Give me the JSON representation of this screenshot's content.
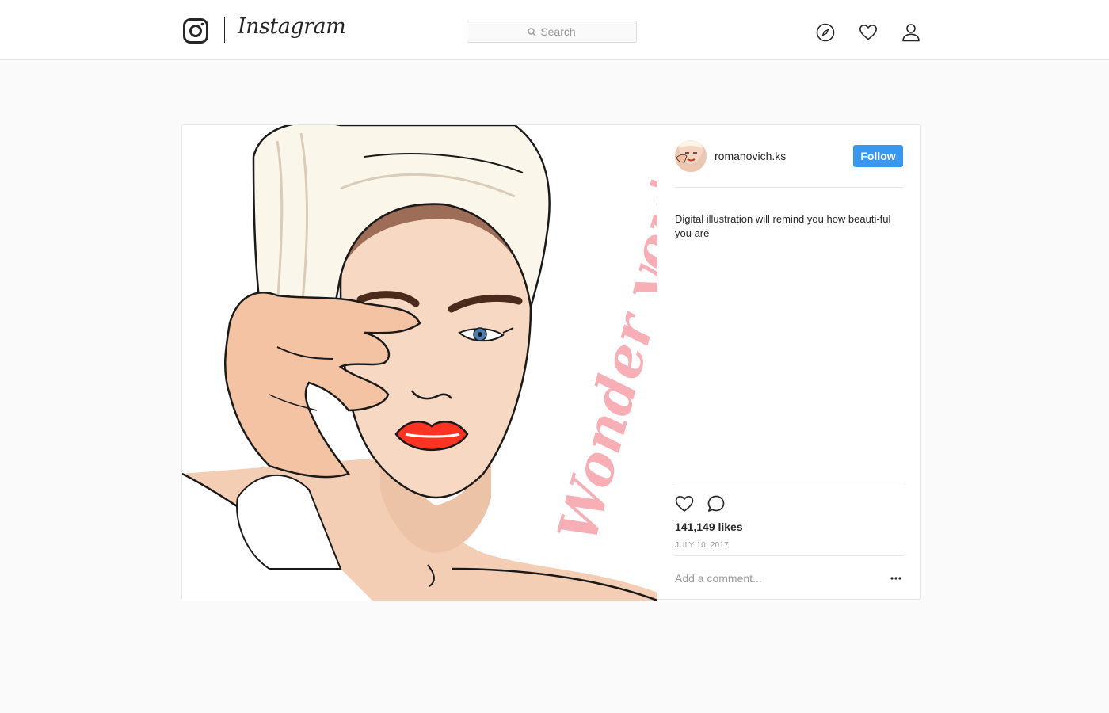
{
  "header": {
    "brand_name": "Instagram",
    "logo_icon": "instagram-camera-icon",
    "search": {
      "placeholder": "Search",
      "icon": "search-icon"
    },
    "nav_icons": [
      "compass-icon",
      "heart-icon",
      "person-icon"
    ]
  },
  "post": {
    "image_icon": "illustration-woman-towel",
    "image_lettering": "Wonder you're",
    "author": {
      "username": "romanovich.ks"
    },
    "follow_label": "Follow",
    "caption": "Digital illustration will remind you how beauti-ful you are",
    "likes_text": "141,149 likes",
    "date_text": "JULY 10, 2017",
    "comment_placeholder": "Add a comment...",
    "more_icon": "more-options-icon"
  },
  "colors": {
    "accent": "#3897f0",
    "text": "#262626",
    "muted": "#999999",
    "border": "#e6e6e6",
    "background": "#fafafa"
  }
}
